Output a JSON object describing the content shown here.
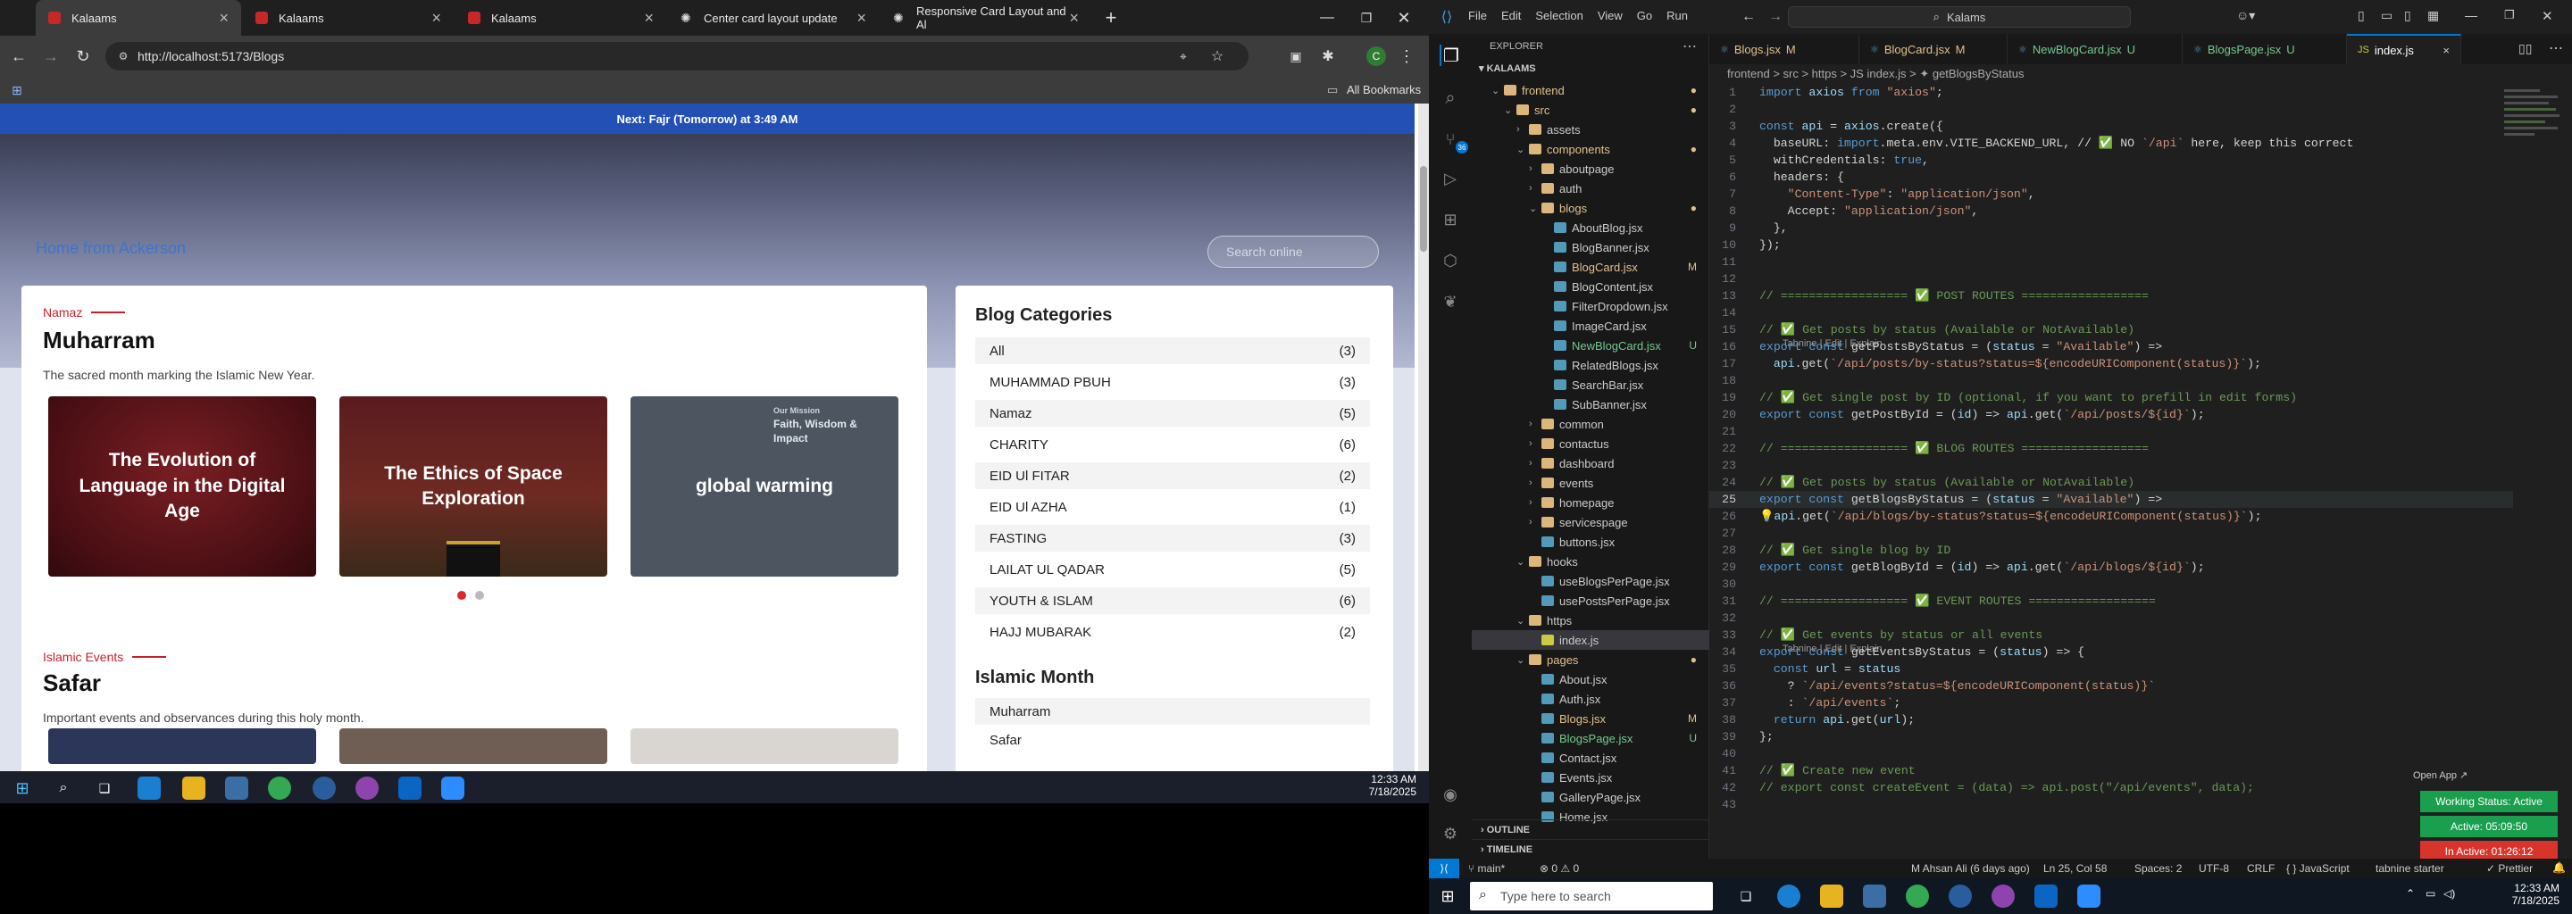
{
  "chrome": {
    "tabs": [
      {
        "title": "Kalaams",
        "active": true
      },
      {
        "title": "Kalaams",
        "active": false
      },
      {
        "title": "Kalaams",
        "active": false
      },
      {
        "title": "Center card layout update",
        "active": false
      },
      {
        "title": "Responsive Card Layout and Al",
        "active": false
      }
    ],
    "url": "http://localhost:5173/Blogs",
    "all_bookmarks": "All Bookmarks",
    "profile_initial": "C"
  },
  "site": {
    "prayer_banner": "Next: Fajr (Tomorrow) at 3:49 AM",
    "hero_title": "Home from Ackerson",
    "search_placeholder": "Search online",
    "sections": [
      {
        "tag": "Namaz",
        "title": "Muharram",
        "description": "The sacred month marking the Islamic New Year.",
        "cards": [
          {
            "title": "The Evolution of Language in the Digital Age"
          },
          {
            "title": "The Ethics of Space Exploration"
          },
          {
            "title": "global warming",
            "overlay_heading": "Faith, Wisdom & Impact",
            "overlay_kicker": "Our Mission"
          }
        ]
      },
      {
        "tag": "Islamic Events",
        "title": "Safar",
        "description": "Important events and observances during this holy month."
      }
    ],
    "blog_categories": {
      "heading": "Blog Categories",
      "items": [
        {
          "name": "All",
          "count": "(3)"
        },
        {
          "name": "MUHAMMAD PBUH",
          "count": "(3)"
        },
        {
          "name": "Namaz",
          "count": "(5)"
        },
        {
          "name": "CHARITY",
          "count": "(6)"
        },
        {
          "name": "EID Ul FITAR",
          "count": "(2)"
        },
        {
          "name": "EID Ul AZHA",
          "count": "(1)"
        },
        {
          "name": "FASTING",
          "count": "(3)"
        },
        {
          "name": "LAILAT UL QADAR",
          "count": "(5)"
        },
        {
          "name": "YOUTH & ISLAM",
          "count": "(6)"
        },
        {
          "name": "HAJJ MUBARAK",
          "count": "(2)"
        }
      ]
    },
    "islamic_month": {
      "heading": "Islamic Month",
      "items": [
        "Muharram",
        "Safar"
      ]
    }
  },
  "left_taskbar": {
    "time": "12:33 AM",
    "date": "7/18/2025"
  },
  "vscode": {
    "menu": [
      "File",
      "Edit",
      "Selection",
      "View",
      "Go",
      "Run"
    ],
    "search": "Kalams",
    "explorer_title": "EXPLORER",
    "root": "KALAAMS",
    "tree": [
      {
        "name": "frontend",
        "depth": 1,
        "kind": "folder-open",
        "badge": "dot-orange",
        "color": "#e2c08d"
      },
      {
        "name": "src",
        "depth": 2,
        "kind": "folder-open",
        "badge": "dot-orange",
        "color": "#e2c08d"
      },
      {
        "name": "assets",
        "depth": 3,
        "kind": "folder",
        "badge": "",
        "color": "#cccccc"
      },
      {
        "name": "components",
        "depth": 3,
        "kind": "folder-open",
        "badge": "dot-orange",
        "color": "#e2c08d"
      },
      {
        "name": "aboutpage",
        "depth": 4,
        "kind": "folder",
        "badge": "",
        "color": "#cccccc"
      },
      {
        "name": "auth",
        "depth": 4,
        "kind": "folder",
        "badge": "",
        "color": "#cccccc"
      },
      {
        "name": "blogs",
        "depth": 4,
        "kind": "folder-open",
        "badge": "dot-orange",
        "color": "#e2c08d"
      },
      {
        "name": "AboutBlog.jsx",
        "depth": 5,
        "kind": "file",
        "badge": "",
        "color": "#cccccc"
      },
      {
        "name": "BlogBanner.jsx",
        "depth": 5,
        "kind": "file",
        "badge": "",
        "color": "#cccccc"
      },
      {
        "name": "BlogCard.jsx",
        "depth": 5,
        "kind": "file",
        "badge": "M",
        "color": "#e2c08d"
      },
      {
        "name": "BlogContent.jsx",
        "depth": 5,
        "kind": "file",
        "badge": "",
        "color": "#cccccc"
      },
      {
        "name": "FilterDropdown.jsx",
        "depth": 5,
        "kind": "file",
        "badge": "",
        "color": "#cccccc"
      },
      {
        "name": "ImageCard.jsx",
        "depth": 5,
        "kind": "file",
        "badge": "",
        "color": "#cccccc"
      },
      {
        "name": "NewBlogCard.jsx",
        "depth": 5,
        "kind": "file",
        "badge": "U",
        "color": "#73c991"
      },
      {
        "name": "RelatedBlogs.jsx",
        "depth": 5,
        "kind": "file",
        "badge": "",
        "color": "#cccccc"
      },
      {
        "name": "SearchBar.jsx",
        "depth": 5,
        "kind": "file",
        "badge": "",
        "color": "#cccccc"
      },
      {
        "name": "SubBanner.jsx",
        "depth": 5,
        "kind": "file",
        "badge": "",
        "color": "#cccccc"
      },
      {
        "name": "common",
        "depth": 4,
        "kind": "folder",
        "badge": "",
        "color": "#cccccc"
      },
      {
        "name": "contactus",
        "depth": 4,
        "kind": "folder",
        "badge": "",
        "color": "#cccccc"
      },
      {
        "name": "dashboard",
        "depth": 4,
        "kind": "folder",
        "badge": "",
        "color": "#cccccc"
      },
      {
        "name": "events",
        "depth": 4,
        "kind": "folder",
        "badge": "",
        "color": "#cccccc"
      },
      {
        "name": "homepage",
        "depth": 4,
        "kind": "folder",
        "badge": "",
        "color": "#cccccc"
      },
      {
        "name": "servicespage",
        "depth": 4,
        "kind": "folder",
        "badge": "",
        "color": "#cccccc"
      },
      {
        "name": "buttons.jsx",
        "depth": 4,
        "kind": "file",
        "badge": "",
        "color": "#cccccc"
      },
      {
        "name": "hooks",
        "depth": 3,
        "kind": "folder-open",
        "badge": "",
        "color": "#cccccc"
      },
      {
        "name": "useBlogsPerPage.jsx",
        "depth": 4,
        "kind": "file",
        "badge": "",
        "color": "#cccccc"
      },
      {
        "name": "usePostsPerPage.jsx",
        "depth": 4,
        "kind": "file",
        "badge": "",
        "color": "#cccccc"
      },
      {
        "name": "https",
        "depth": 3,
        "kind": "folder-open",
        "badge": "",
        "color": "#cccccc"
      },
      {
        "name": "index.js",
        "depth": 4,
        "kind": "file",
        "badge": "",
        "color": "#cccccc",
        "selected": true
      },
      {
        "name": "pages",
        "depth": 3,
        "kind": "folder-open",
        "badge": "dot-orange",
        "color": "#e2c08d"
      },
      {
        "name": "About.jsx",
        "depth": 4,
        "kind": "file",
        "badge": "",
        "color": "#cccccc"
      },
      {
        "name": "Auth.jsx",
        "depth": 4,
        "kind": "file",
        "badge": "",
        "color": "#cccccc"
      },
      {
        "name": "Blogs.jsx",
        "depth": 4,
        "kind": "file",
        "badge": "M",
        "color": "#e2c08d"
      },
      {
        "name": "BlogsPage.jsx",
        "depth": 4,
        "kind": "file",
        "badge": "U",
        "color": "#73c991"
      },
      {
        "name": "Contact.jsx",
        "depth": 4,
        "kind": "file",
        "badge": "",
        "color": "#cccccc"
      },
      {
        "name": "Events.jsx",
        "depth": 4,
        "kind": "file",
        "badge": "",
        "color": "#cccccc"
      },
      {
        "name": "GalleryPage.jsx",
        "depth": 4,
        "kind": "file",
        "badge": "",
        "color": "#cccccc"
      },
      {
        "name": "Home.jsx",
        "depth": 4,
        "kind": "file",
        "badge": "",
        "color": "#cccccc"
      }
    ],
    "outline": "OUTLINE",
    "timeline": "TIMELINE",
    "editor_tabs": [
      {
        "label": "Blogs.jsx",
        "badge": "M",
        "color": "#e2c08d",
        "active": false
      },
      {
        "label": "BlogCard.jsx",
        "badge": "M",
        "color": "#e2c08d",
        "active": false
      },
      {
        "label": "NewBlogCard.jsx",
        "badge": "U",
        "color": "#73c991",
        "active": false
      },
      {
        "label": "BlogsPage.jsx",
        "badge": "U",
        "color": "#73c991",
        "active": false
      },
      {
        "label": "index.js",
        "badge": "",
        "color": "#ffffff",
        "active": true
      }
    ],
    "breadcrumb": "frontend > src > https > JS index.js > ✦ getBlogsByStatus",
    "code": [
      {
        "n": "1",
        "text": "import axios from \"axios\";"
      },
      {
        "n": "2",
        "text": ""
      },
      {
        "n": "3",
        "text": "const api = axios.create({"
      },
      {
        "n": "4",
        "text": "  baseURL: import.meta.env.VITE_BACKEND_URL, // ✅ NO `/api` here, keep this correct"
      },
      {
        "n": "5",
        "text": "  withCredentials: true,"
      },
      {
        "n": "6",
        "text": "  headers: {"
      },
      {
        "n": "7",
        "text": "    \"Content-Type\": \"application/json\","
      },
      {
        "n": "8",
        "text": "    Accept: \"application/json\","
      },
      {
        "n": "9",
        "text": "  },"
      },
      {
        "n": "10",
        "text": "});"
      },
      {
        "n": "11",
        "text": ""
      },
      {
        "n": "12",
        "text": ""
      },
      {
        "n": "13",
        "text": "// ================== ✅ POST ROUTES =================="
      },
      {
        "n": "14",
        "text": ""
      },
      {
        "n": "15",
        "text": "// ✅ Get posts by status (Available or NotAvailable)",
        "lens": "Tabnine | Edit | Explain"
      },
      {
        "n": "16",
        "text": "export const getPostsByStatus = (status = \"Available\") =>"
      },
      {
        "n": "17",
        "text": "  api.get(`/api/posts/by-status?status=${encodeURIComponent(status)}`);"
      },
      {
        "n": "18",
        "text": ""
      },
      {
        "n": "19",
        "text": "// ✅ Get single post by ID (optional, if you want to prefill in edit forms)"
      },
      {
        "n": "20",
        "text": "export const getPostById = (id) => api.get(`/api/posts/${id}`);"
      },
      {
        "n": "21",
        "text": ""
      },
      {
        "n": "22",
        "text": "// ================== ✅ BLOG ROUTES =================="
      },
      {
        "n": "23",
        "text": ""
      },
      {
        "n": "24",
        "text": "// ✅ Get posts by status (Available or NotAvailable)",
        "lens": "Tabnine | Edit | Explain"
      },
      {
        "n": "25",
        "text": "export const getBlogsByStatus = (status = \"Available\") =>"
      },
      {
        "n": "26",
        "text": "💡api.get(`/api/blogs/by-status?status=${encodeURIComponent(status)}`);"
      },
      {
        "n": "27",
        "text": ""
      },
      {
        "n": "28",
        "text": "// ✅ Get single blog by ID"
      },
      {
        "n": "29",
        "text": "export const getBlogById = (id) => api.get(`/api/blogs/${id}`);"
      },
      {
        "n": "30",
        "text": ""
      },
      {
        "n": "31",
        "text": "// ================== ✅ EVENT ROUTES =================="
      },
      {
        "n": "32",
        "text": ""
      },
      {
        "n": "33",
        "text": "// ✅ Get events by status or all events",
        "lens": "Tabnine | Edit | Explain"
      },
      {
        "n": "34",
        "text": "export const getEventsByStatus = (status) => {"
      },
      {
        "n": "35",
        "text": "  const url = status"
      },
      {
        "n": "36",
        "text": "    ? `/api/events?status=${encodeURIComponent(status)}`"
      },
      {
        "n": "37",
        "text": "    : `/api/events`;"
      },
      {
        "n": "38",
        "text": "  return api.get(url);"
      },
      {
        "n": "39",
        "text": "};"
      },
      {
        "n": "40",
        "text": ""
      },
      {
        "n": "41",
        "text": "// ✅ Create new event"
      },
      {
        "n": "42",
        "text": "// export const createEvent = (data) => api.post(\"/api/events\", data);"
      },
      {
        "n": "43",
        "text": ""
      }
    ],
    "open_app": "Open App ↗",
    "working_status": "Working Status: Active",
    "active_time": "Active: 05:09:50",
    "inactive_time": "In Active: 01:26:12",
    "status_bar": {
      "branch": "main*",
      "problems": "⊗ 0 ⚠ 0",
      "author": "M Ahsan Ali (6 days ago)",
      "position": "Ln 25, Col 58",
      "spaces": "Spaces: 2",
      "encoding": "UTF-8",
      "eol": "CRLF",
      "language": "{ } JavaScript",
      "tabnine": "tabnine starter",
      "prettier": "✓ Prettier"
    }
  },
  "taskbar": {
    "search_placeholder": "Type here to search",
    "time": "12:33 AM",
    "date": "7/18/2025"
  },
  "colors": {
    "accent_red": "#c71f2a",
    "brand_blue": "#2350b4",
    "vscode_blue": "#0078d4",
    "status_green": "#1a9f4e",
    "status_red": "#d9342b"
  }
}
